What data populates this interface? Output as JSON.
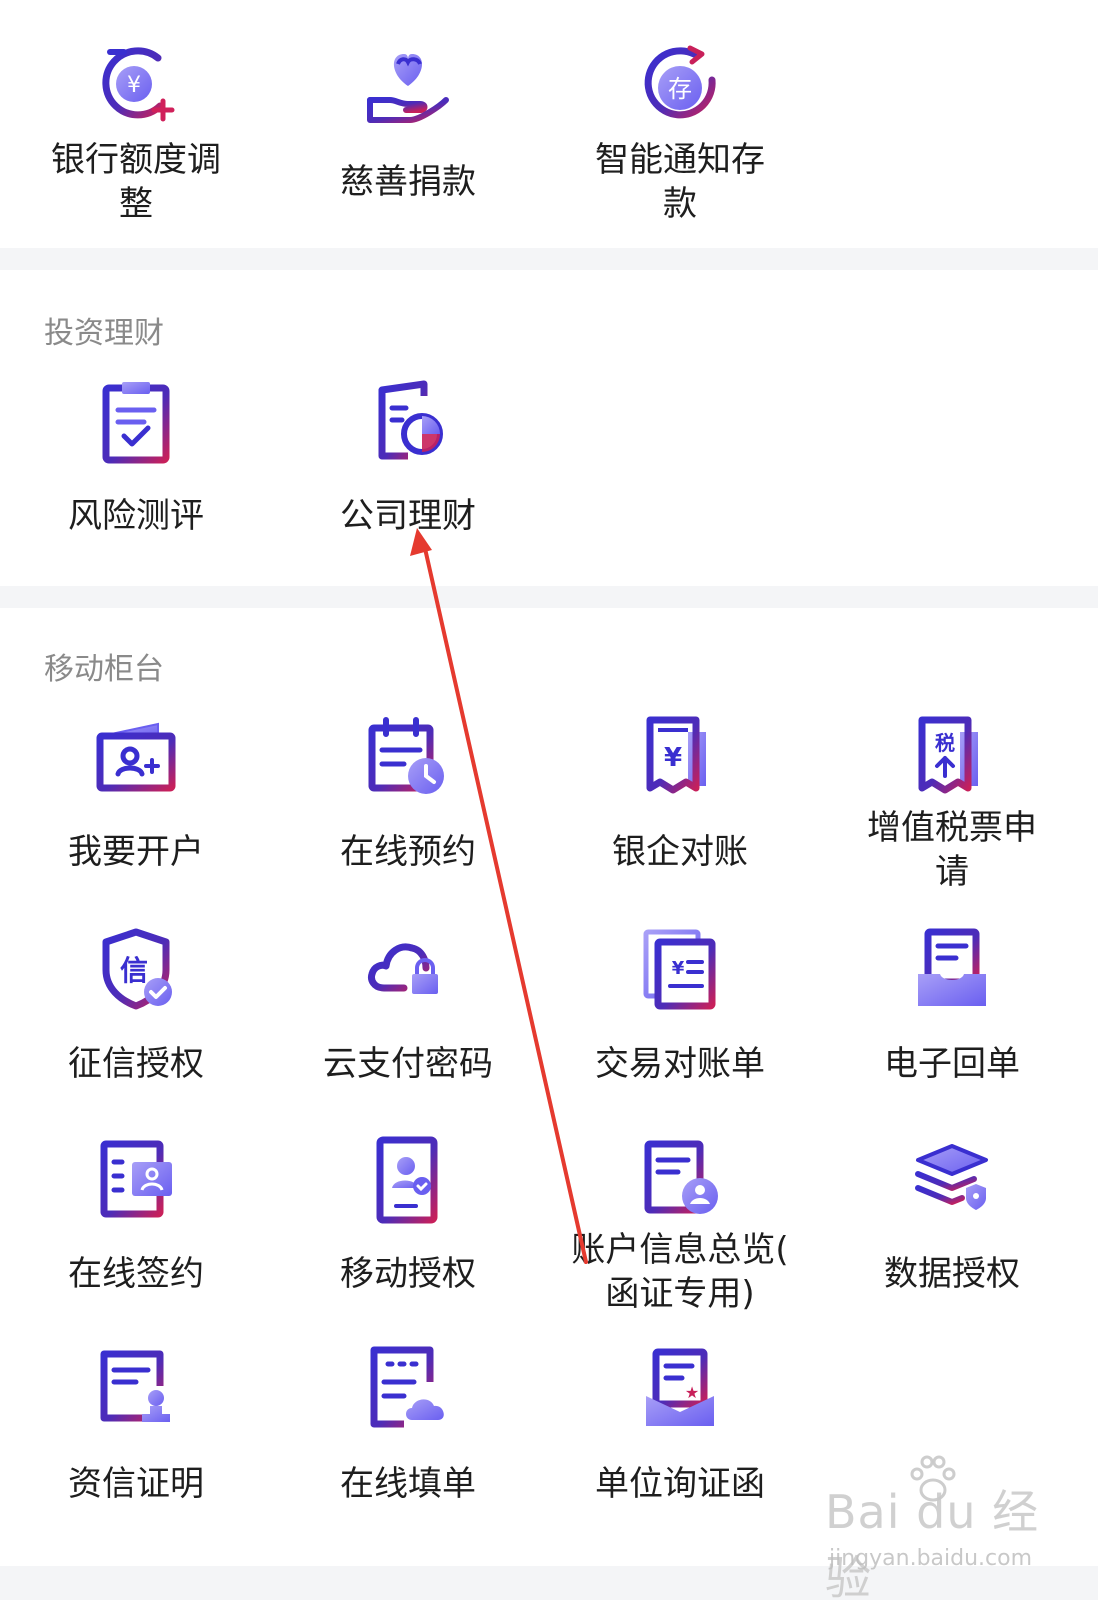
{
  "top_row": [
    {
      "label": "银行额度调整",
      "icon": "bank-limit-adjust-icon"
    },
    {
      "label": "慈善捐款",
      "icon": "charity-heart-hand-icon"
    },
    {
      "label": "智能通知存款",
      "icon": "smart-deposit-icon"
    }
  ],
  "invest": {
    "title": "投资理财",
    "items": [
      {
        "label": "风险测评",
        "icon": "risk-assessment-clipboard-icon"
      },
      {
        "label": "公司理财",
        "icon": "company-finance-chart-icon"
      }
    ]
  },
  "mobile_counter": {
    "title": "移动柜台",
    "items": [
      {
        "label": "我要开户",
        "icon": "open-account-card-icon"
      },
      {
        "label": "在线预约",
        "icon": "online-appointment-calendar-icon"
      },
      {
        "label": "银企对账",
        "icon": "bank-reconciliation-icon"
      },
      {
        "label": "增值税票申请",
        "icon": "vat-invoice-icon"
      },
      {
        "label": "征信授权",
        "icon": "credit-authorization-shield-icon"
      },
      {
        "label": "云支付密码",
        "icon": "cloud-pay-password-icon"
      },
      {
        "label": "交易对账单",
        "icon": "transaction-statement-icon"
      },
      {
        "label": "电子回单",
        "icon": "electronic-receipt-icon"
      },
      {
        "label": "在线签约",
        "icon": "online-signing-icon"
      },
      {
        "label": "移动授权",
        "icon": "mobile-authorization-icon"
      },
      {
        "label": "账户信息总览(函证专用)",
        "icon": "account-info-overview-icon"
      },
      {
        "label": "数据授权",
        "icon": "data-authorization-layers-icon"
      },
      {
        "label": "资信证明",
        "icon": "credit-certificate-icon"
      },
      {
        "label": "在线填单",
        "icon": "online-form-cloud-icon"
      },
      {
        "label": "单位询证函",
        "icon": "confirmation-letter-icon"
      }
    ]
  },
  "watermark": {
    "main": "Bai du 经验",
    "sub": "jingyan.baidu.com"
  },
  "colors": {
    "icon_primary": "#3b34c9",
    "icon_accent": "#c21f5b",
    "icon_light": "#8f86f2",
    "arrow": "#e53a2f"
  }
}
